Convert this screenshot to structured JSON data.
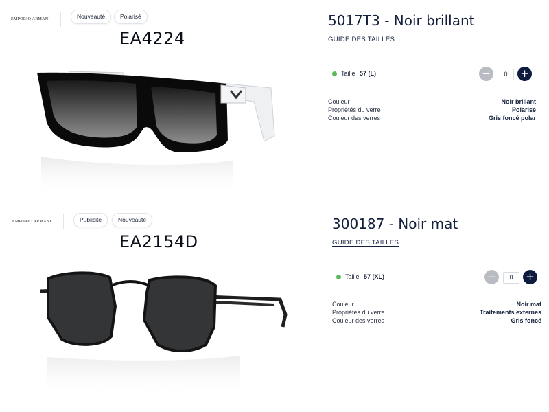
{
  "products": [
    {
      "brand": "EMPORIO ARMANI",
      "badges": [
        "Nouveauté",
        "Polarisé"
      ],
      "model": "EA4224",
      "title": "5017T3 - Noir brillant",
      "size_guide": "GUIDE DES TAILLES",
      "size_label": "Taille",
      "size_value": "57 (L)",
      "quantity": "0",
      "specs": [
        {
          "label": "Couleur",
          "value": "Noir brillant"
        },
        {
          "label": "Propriétés du verre",
          "value": "Polarisé"
        },
        {
          "label": "Couleur des verres",
          "value": "Gris foncé polar"
        }
      ]
    },
    {
      "brand": "EMPORIO ARMANI",
      "badges": [
        "Publicité",
        "Nouveauté"
      ],
      "model": "EA2154D",
      "title": "300187 - Noir mat",
      "size_guide": "GUIDE DES TAILLES",
      "size_label": "Taille",
      "size_value": "57 (XL)",
      "quantity": "0",
      "specs": [
        {
          "label": "Couleur",
          "value": "Noir mat"
        },
        {
          "label": "Propriétés du verre",
          "value": "Traitements externes"
        },
        {
          "label": "Couleur des verres",
          "value": "Gris foncé"
        }
      ]
    }
  ],
  "colors": {
    "availability_dot": "#5cb85c",
    "minus_button": "#b9bcc2",
    "plus_button": "#0d1b3e",
    "text_primary": "#14213d"
  },
  "icons": {
    "minus": "minus-icon",
    "plus": "plus-icon"
  }
}
